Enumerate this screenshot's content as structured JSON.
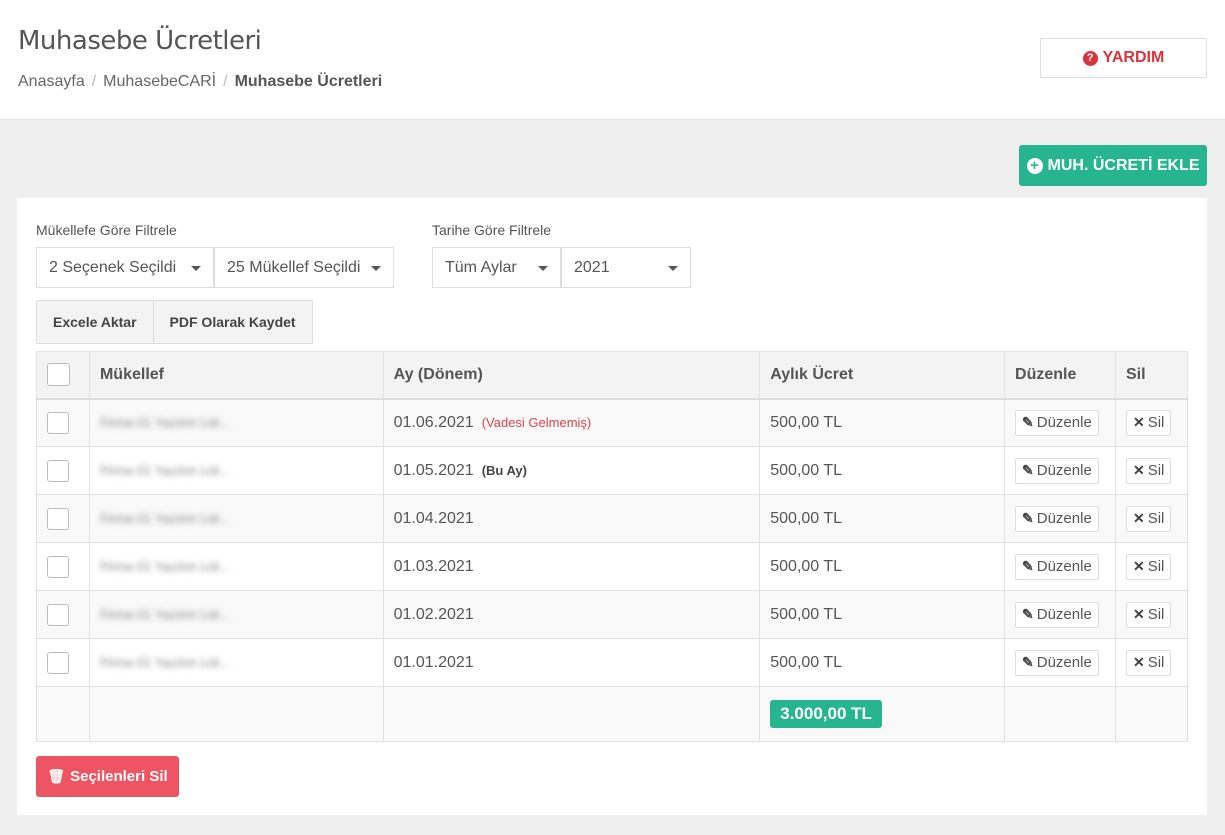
{
  "header": {
    "title": "Muhasebe Ücretleri",
    "breadcrumb": [
      "Anasayfa",
      "MuhasebeCARİ",
      "Muhasebe Ücretleri"
    ],
    "help_label": "YARDIM"
  },
  "add_label": "MUH. ÜCRETİ EKLE",
  "filters": {
    "taxpayer_label": "Mükellefe Göre Filtrele",
    "taxpayer_select_1": "2 Seçenek Seçildi",
    "taxpayer_select_2": "25 Mükellef Seçildi",
    "date_label": "Tarihe Göre Filtrele",
    "month_select": "Tüm Aylar",
    "year_select": "2021"
  },
  "export": {
    "excel_label": "Excele Aktar",
    "pdf_label": "PDF Olarak Kaydet"
  },
  "table": {
    "headers": [
      "Mükellef",
      "Ay (Dönem)",
      "Aylık Ücret",
      "Düzenle",
      "Sil"
    ],
    "rows": [
      {
        "taxpayer": "Firma 01 Yazılım Ltd...",
        "period": "01.06.2021",
        "note": "(Vadesi Gelmemiş)",
        "fee": "500,00 TL"
      },
      {
        "taxpayer": "Firma 01 Yazılım Ltd...",
        "period": "01.05.2021",
        "note": "(Bu Ay)",
        "fee": "500,00 TL"
      },
      {
        "taxpayer": "Firma 01 Yazılım Ltd...",
        "period": "01.04.2021",
        "note": "",
        "fee": "500,00 TL"
      },
      {
        "taxpayer": "Firma 01 Yazılım Ltd...",
        "period": "01.03.2021",
        "note": "",
        "fee": "500,00 TL"
      },
      {
        "taxpayer": "Firma 01 Yazılım Ltd...",
        "period": "01.02.2021",
        "note": "",
        "fee": "500,00 TL"
      },
      {
        "taxpayer": "Firma 01 Yazılım Ltd...",
        "period": "01.01.2021",
        "note": "",
        "fee": "500,00 TL"
      }
    ],
    "edit_label": "Düzenle",
    "delete_label": "Sil",
    "total": "3.000,00 TL"
  },
  "delete_selected_label": "Seçilenleri Sil",
  "colors": {
    "accent": "#26b58e",
    "danger": "#ef5462",
    "help": "#d9343b"
  }
}
